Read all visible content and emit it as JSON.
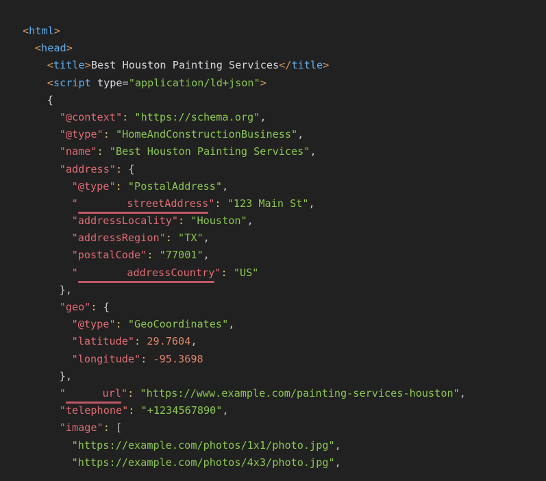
{
  "editor": {
    "background_color": "#212121",
    "default_text_color": "#b9bcc0",
    "language": "html",
    "colors": {
      "tag": "#61afef",
      "bracket": "#d19a66",
      "attribute": "#d7dae0",
      "string": "#8cc653",
      "json_key": "#e06c75",
      "colon": "#e5c07b",
      "number": "#e0856c",
      "punctuation": "#c3c7cb",
      "spellcheck_underline": "#c2566a"
    }
  },
  "code": {
    "lines": [
      {
        "indent": 0,
        "tokens": [
          {
            "t": "bracket",
            "v": "<"
          },
          {
            "t": "tag",
            "v": "html"
          },
          {
            "t": "bracket",
            "v": ">"
          }
        ]
      },
      {
        "indent": 1,
        "tokens": [
          {
            "t": "bracket",
            "v": "<"
          },
          {
            "t": "tag",
            "v": "head"
          },
          {
            "t": "bracket",
            "v": ">"
          }
        ]
      },
      {
        "indent": 2,
        "tokens": [
          {
            "t": "bracket",
            "v": "<"
          },
          {
            "t": "tag",
            "v": "title"
          },
          {
            "t": "bracket",
            "v": ">"
          },
          {
            "t": "text",
            "v": "Best Houston Painting Services"
          },
          {
            "t": "bracket",
            "v": "</"
          },
          {
            "t": "tag",
            "v": "title"
          },
          {
            "t": "bracket",
            "v": ">"
          }
        ]
      },
      {
        "indent": 2,
        "tokens": [
          {
            "t": "bracket",
            "v": "<"
          },
          {
            "t": "tag",
            "v": "script"
          },
          {
            "t": "attr",
            "v": " type"
          },
          {
            "t": "eq",
            "v": "="
          },
          {
            "t": "string",
            "v": "\"application/ld+json\""
          },
          {
            "t": "bracket",
            "v": ">"
          }
        ]
      },
      {
        "indent": 2,
        "tokens": [
          {
            "t": "punct",
            "v": "{"
          }
        ]
      },
      {
        "indent": 3,
        "tokens": [
          {
            "t": "key",
            "v": "\"@context\""
          },
          {
            "t": "colon",
            "v": ":"
          },
          {
            "t": "string",
            "v": " \"https://schema.org\""
          },
          {
            "t": "punct",
            "v": ","
          }
        ]
      },
      {
        "indent": 3,
        "tokens": [
          {
            "t": "key",
            "v": "\"@type\""
          },
          {
            "t": "colon",
            "v": ":"
          },
          {
            "t": "string",
            "v": " \"HomeAndConstructionBusiness\""
          },
          {
            "t": "punct",
            "v": ","
          }
        ]
      },
      {
        "indent": 3,
        "tokens": [
          {
            "t": "key",
            "v": "\"name\""
          },
          {
            "t": "colon",
            "v": ":"
          },
          {
            "t": "string",
            "v": " \"Best Houston Painting Services\""
          },
          {
            "t": "punct",
            "v": ","
          }
        ]
      },
      {
        "indent": 3,
        "tokens": [
          {
            "t": "key",
            "v": "\"address\""
          },
          {
            "t": "colon",
            "v": ":"
          },
          {
            "t": "punct",
            "v": " {"
          }
        ]
      },
      {
        "indent": 4,
        "tokens": [
          {
            "t": "key",
            "v": "\"@type\""
          },
          {
            "t": "colon",
            "v": ":"
          },
          {
            "t": "string",
            "v": " \"PostalAddress\""
          },
          {
            "t": "punct",
            "v": ","
          }
        ]
      },
      {
        "indent": 4,
        "tokens": [
          {
            "t": "key",
            "v": "\""
          },
          {
            "t": "key-underline",
            "v": "streetAddress"
          },
          {
            "t": "key",
            "v": "\""
          },
          {
            "t": "colon",
            "v": ":"
          },
          {
            "t": "string",
            "v": " \"123 Main St\""
          },
          {
            "t": "punct",
            "v": ","
          }
        ]
      },
      {
        "indent": 4,
        "tokens": [
          {
            "t": "key",
            "v": "\"addressLocality\""
          },
          {
            "t": "colon",
            "v": ":"
          },
          {
            "t": "string",
            "v": " \"Houston\""
          },
          {
            "t": "punct",
            "v": ","
          }
        ]
      },
      {
        "indent": 4,
        "tokens": [
          {
            "t": "key",
            "v": "\"addressRegion\""
          },
          {
            "t": "colon",
            "v": ":"
          },
          {
            "t": "string",
            "v": " \"TX\""
          },
          {
            "t": "punct",
            "v": ","
          }
        ]
      },
      {
        "indent": 4,
        "tokens": [
          {
            "t": "key",
            "v": "\"postalCode\""
          },
          {
            "t": "colon",
            "v": ":"
          },
          {
            "t": "string",
            "v": " \"77001\""
          },
          {
            "t": "punct",
            "v": ","
          }
        ]
      },
      {
        "indent": 4,
        "tokens": [
          {
            "t": "key",
            "v": "\""
          },
          {
            "t": "key-underline",
            "v": "addressCountry"
          },
          {
            "t": "key",
            "v": "\""
          },
          {
            "t": "colon",
            "v": ":"
          },
          {
            "t": "string",
            "v": " \"US\""
          }
        ]
      },
      {
        "indent": 3,
        "tokens": [
          {
            "t": "punct",
            "v": "},"
          }
        ]
      },
      {
        "indent": 3,
        "tokens": [
          {
            "t": "key",
            "v": "\"geo\""
          },
          {
            "t": "colon",
            "v": ":"
          },
          {
            "t": "punct",
            "v": " {"
          }
        ]
      },
      {
        "indent": 4,
        "tokens": [
          {
            "t": "key",
            "v": "\"@type\""
          },
          {
            "t": "colon",
            "v": ":"
          },
          {
            "t": "string",
            "v": " \"GeoCoordinates\""
          },
          {
            "t": "punct",
            "v": ","
          }
        ]
      },
      {
        "indent": 4,
        "tokens": [
          {
            "t": "key",
            "v": "\"latitude\""
          },
          {
            "t": "colon",
            "v": ":"
          },
          {
            "t": "num",
            "v": " 29.7604"
          },
          {
            "t": "punct",
            "v": ","
          }
        ]
      },
      {
        "indent": 4,
        "tokens": [
          {
            "t": "key",
            "v": "\"longitude\""
          },
          {
            "t": "colon",
            "v": ":"
          },
          {
            "t": "num",
            "v": " -95.3698"
          }
        ]
      },
      {
        "indent": 3,
        "tokens": [
          {
            "t": "punct",
            "v": "},"
          }
        ]
      },
      {
        "indent": 3,
        "tokens": [
          {
            "t": "key",
            "v": "\""
          },
          {
            "t": "key-underline",
            "v": "url"
          },
          {
            "t": "key",
            "v": "\""
          },
          {
            "t": "colon",
            "v": ":"
          },
          {
            "t": "string",
            "v": " \"https://www.example.com/painting-services-houston\""
          },
          {
            "t": "punct",
            "v": ","
          }
        ]
      },
      {
        "indent": 3,
        "tokens": [
          {
            "t": "key",
            "v": "\"telephone\""
          },
          {
            "t": "colon",
            "v": ":"
          },
          {
            "t": "string",
            "v": " \"+1234567890\""
          },
          {
            "t": "punct",
            "v": ","
          }
        ]
      },
      {
        "indent": 3,
        "tokens": [
          {
            "t": "key",
            "v": "\"image\""
          },
          {
            "t": "colon",
            "v": ":"
          },
          {
            "t": "punct",
            "v": " ["
          }
        ]
      },
      {
        "indent": 4,
        "tokens": [
          {
            "t": "string",
            "v": "\"https://example.com/photos/1x1/photo.jpg\""
          },
          {
            "t": "punct",
            "v": ","
          }
        ]
      },
      {
        "indent": 4,
        "tokens": [
          {
            "t": "string",
            "v": "\"https://example.com/photos/4x3/photo.jpg\""
          },
          {
            "t": "punct",
            "v": ","
          }
        ]
      }
    ]
  }
}
